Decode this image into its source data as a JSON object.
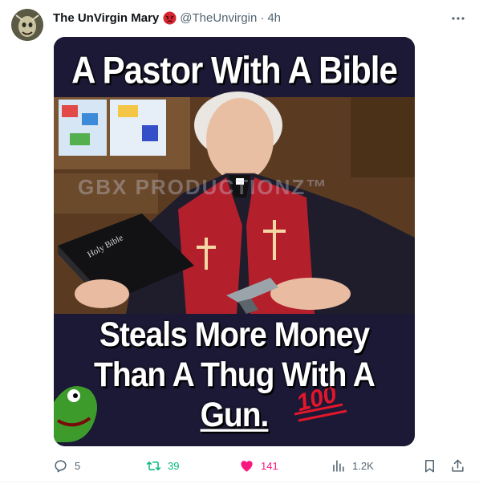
{
  "post": {
    "display_name": "The UnVirgin Mary",
    "handle": "@TheUnvirgin",
    "separator": "·",
    "time": "4h"
  },
  "media": {
    "top_text": "A Pastor With A Bible",
    "bottom_line_1": "Steals More Money",
    "bottom_line_2": "Than A Thug With A",
    "bottom_line_3": "Gun.",
    "watermark": "GBX PRODUCTIONZ™",
    "bible_label": "Holy Bible"
  },
  "actions": {
    "replies": "5",
    "reposts": "39",
    "likes": "141",
    "views": "1.2K"
  },
  "icons": {
    "avatar": "avatar-image",
    "badge": "angry-face-emoji-icon",
    "more": "more-dots-icon",
    "reply": "reply-icon",
    "repost": "repost-icon",
    "like": "heart-icon",
    "views": "views-icon",
    "bookmark": "bookmark-icon",
    "share": "share-icon"
  },
  "colors": {
    "repost_active": "#00ba7c",
    "like_active": "#f91880",
    "secondary_text": "#536471"
  }
}
